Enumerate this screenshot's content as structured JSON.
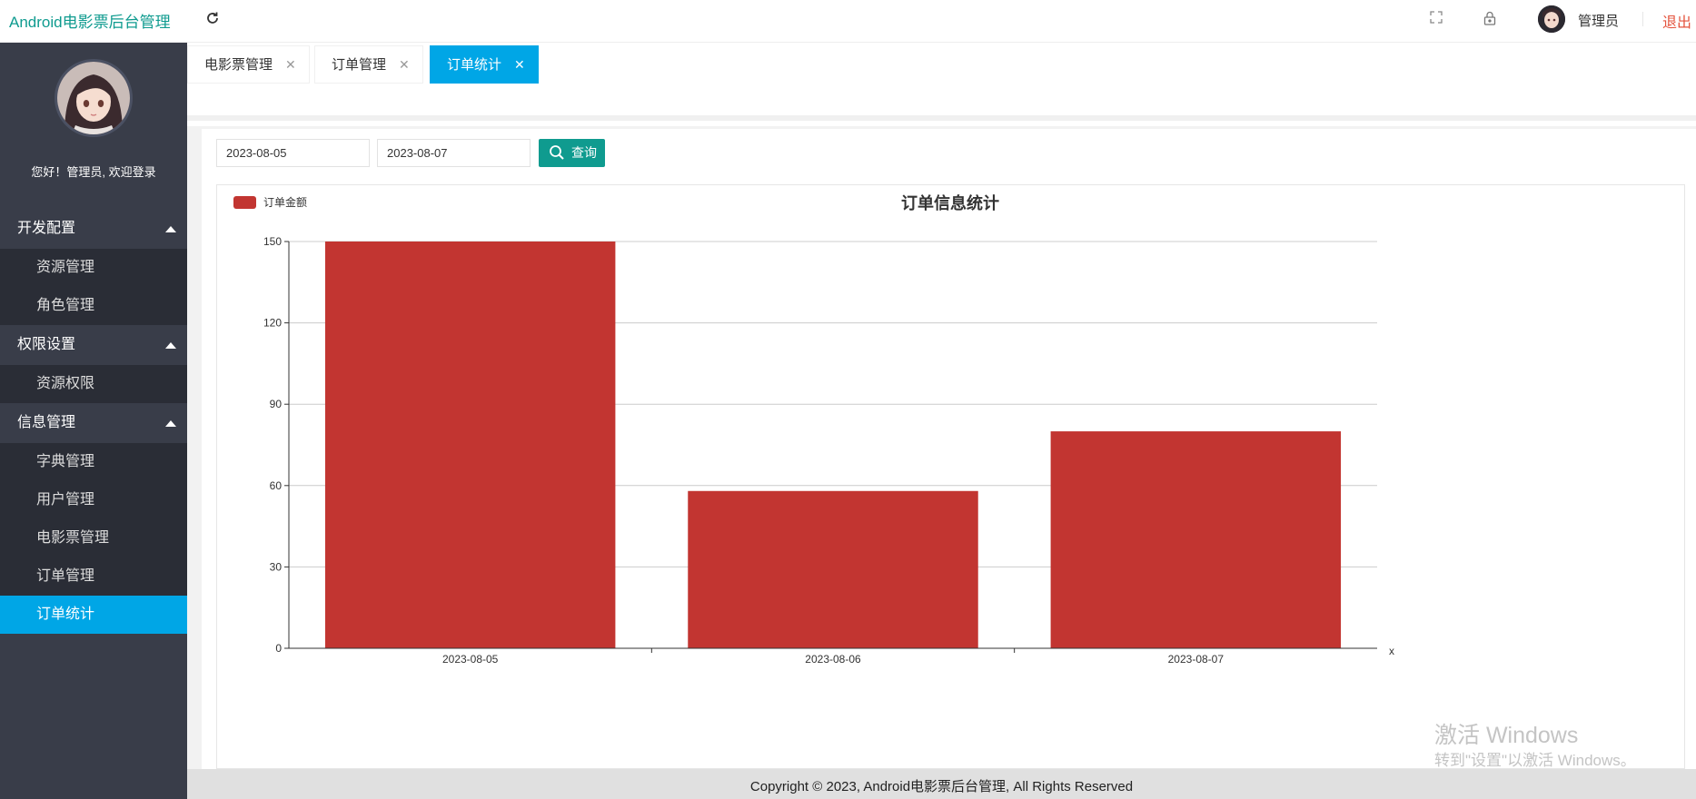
{
  "header": {
    "app_title": "Android电影票后台管理",
    "refresh_icon": "refresh-icon",
    "user_name": "管理员",
    "logout_label": "退出",
    "brand_color": "#0f9b8f"
  },
  "sidebar": {
    "welcome": "您好！管理员, 欢迎登录",
    "groups": [
      {
        "label": "开发配置",
        "items": [
          "资源管理",
          "角色管理"
        ]
      },
      {
        "label": "权限设置",
        "items": [
          "资源权限"
        ]
      },
      {
        "label": "信息管理",
        "items": [
          "字典管理",
          "用户管理",
          "电影票管理",
          "订单管理",
          "订单统计"
        ]
      }
    ],
    "active_item": "订单统计",
    "accent_color": "#00a6e6"
  },
  "tabs": [
    {
      "label": "电影票管理",
      "active": false
    },
    {
      "label": "订单管理",
      "active": false
    },
    {
      "label": "订单统计",
      "active": true
    }
  ],
  "filter": {
    "start_date": "2023-08-05",
    "end_date": "2023-08-07",
    "search_label": "查询"
  },
  "chart_data": {
    "type": "bar",
    "title": "订单信息统计",
    "legend": [
      "订单金额"
    ],
    "legend_position": "top-left",
    "categories": [
      "2023-08-05",
      "2023-08-06",
      "2023-08-07"
    ],
    "series": [
      {
        "name": "订单金额",
        "values": [
          150,
          58,
          80
        ],
        "color": "#c23531"
      }
    ],
    "xlabel": "x",
    "ylabel": "",
    "ylim": [
      0,
      150
    ],
    "yticks": [
      0,
      30,
      60,
      90,
      120,
      150
    ],
    "grid": true
  },
  "watermark": {
    "line1": "激活 Windows",
    "line2": "转到\"设置\"以激活 Windows。"
  },
  "footer": {
    "copyright": "Copyright © 2023, Android电影票后台管理, All Rights Reserved"
  }
}
